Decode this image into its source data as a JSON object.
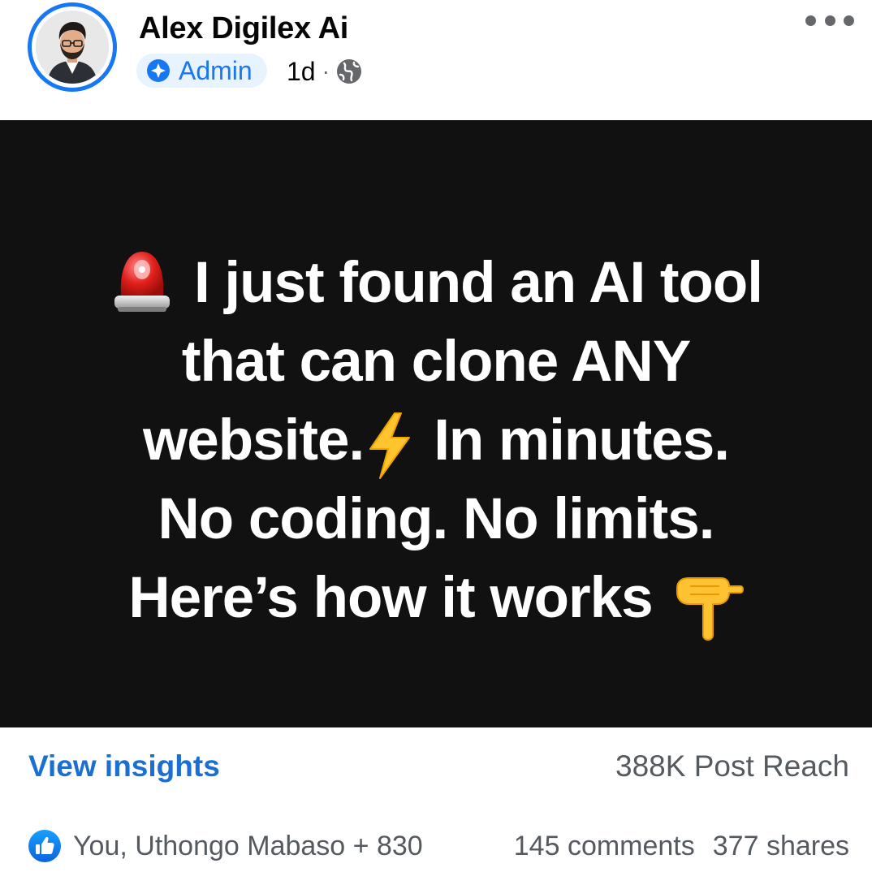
{
  "header": {
    "author_name": "Alex Digilex Ai",
    "role_badge": "Admin",
    "time_ago": "1d",
    "separator": "·",
    "audience_icon": "globe-icon",
    "badge_icon": "admin-shield-icon",
    "menu_icon": "more-options-icon"
  },
  "post": {
    "background_color": "#111111",
    "lines": [
      "I just found an AI tool",
      "that can clone ANY",
      "website.",
      "In minutes.",
      "No coding. No limits.",
      "Here’s how it works"
    ],
    "emojis": [
      "siren-icon",
      "lightning-bolt-icon",
      "pointing-down-icon"
    ]
  },
  "footer": {
    "insights_label": "View insights",
    "reach": "388K Post Reach",
    "reaction_icon": "like-icon",
    "reactors": "You, Uthongo Mabaso + 830",
    "comments": "145 comments",
    "shares": "377 shares"
  },
  "colors": {
    "accent": "#1877f2",
    "link": "#1b6fd1",
    "secondary_text": "#555a60",
    "badge_bg": "#e7f3ff"
  }
}
